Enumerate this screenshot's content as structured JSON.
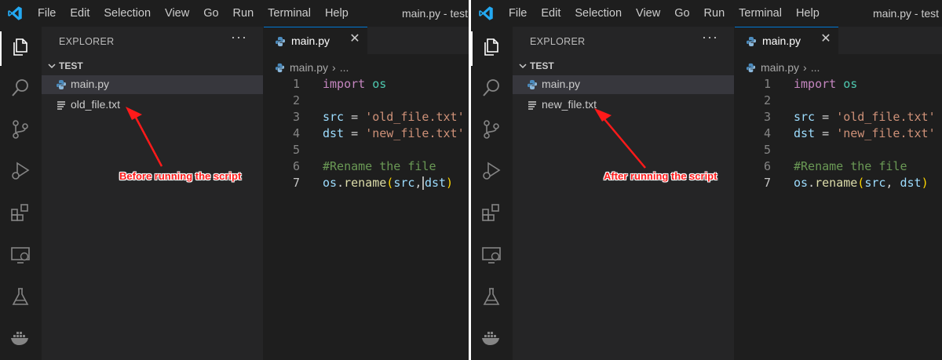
{
  "panels": [
    {
      "menu": [
        "File",
        "Edit",
        "Selection",
        "View",
        "Go",
        "Run",
        "Terminal",
        "Help"
      ],
      "window_title": "main.py - test -",
      "explorer": {
        "title": "EXPLORER",
        "more": "···",
        "folder": "TEST",
        "files": [
          "main.py",
          "old_file.txt"
        ]
      },
      "tab": {
        "label": "main.py",
        "close": "✕"
      },
      "breadcrumb": {
        "file": "main.py",
        "sep": "›",
        "more": "..."
      },
      "code_lines": [
        {
          "n": "1"
        },
        {
          "n": "2"
        },
        {
          "n": "3"
        },
        {
          "n": "4"
        },
        {
          "n": "5"
        },
        {
          "n": "6"
        },
        {
          "n": "7"
        }
      ],
      "annotation": "Before running the script"
    },
    {
      "menu": [
        "File",
        "Edit",
        "Selection",
        "View",
        "Go",
        "Run",
        "Terminal",
        "Help"
      ],
      "window_title": "main.py - test -",
      "explorer": {
        "title": "EXPLORER",
        "more": "···",
        "folder": "TEST",
        "files": [
          "main.py",
          "new_file.txt"
        ]
      },
      "tab": {
        "label": "main.py",
        "close": "✕"
      },
      "breadcrumb": {
        "file": "main.py",
        "sep": "›",
        "more": "..."
      },
      "code_lines": [
        {
          "n": "1"
        },
        {
          "n": "2"
        },
        {
          "n": "3"
        },
        {
          "n": "4"
        },
        {
          "n": "5"
        },
        {
          "n": "6"
        },
        {
          "n": "7"
        }
      ],
      "annotation": "After running the script"
    }
  ],
  "code": {
    "import_kw": "import",
    "module": "os",
    "src_var": "src",
    "dst_var": "dst",
    "equals": "=",
    "src_value": "'old_file.txt'",
    "dst_value": "'new_file.txt'",
    "comment": "#Rename the file",
    "os_obj": "os",
    "dot": ".",
    "func": "rename",
    "paren_open": "(",
    "comma": ",",
    "paren_close": ")"
  },
  "colors": {
    "editor_bg": "#1e1e1e",
    "sidebar_bg": "#252526",
    "keyword": "#c586c0",
    "string": "#ce9178",
    "comment": "#6a9955",
    "annotation": "#ff1a1a"
  }
}
